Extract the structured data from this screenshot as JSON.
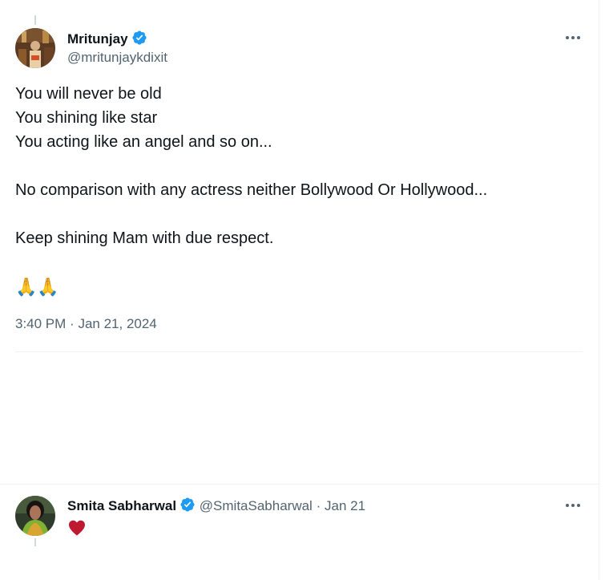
{
  "main_tweet": {
    "author_name": "Mritunjay",
    "author_handle": "@mritunjaykdixit",
    "verified": true,
    "lines": [
      "You will never be old",
      "You shining like star",
      "You acting like an angel and so on...",
      "",
      "No comparison with any actress neither Bollywood Or Hollywood...",
      "",
      "Keep shining Mam with due respect."
    ],
    "emoji": "🙏🙏",
    "time": "3:40 PM",
    "date": "Jan 21, 2024",
    "separator": "·",
    "more_icon": "more-horizontal-icon"
  },
  "reply": {
    "author_name": "Smita Sabharwal",
    "author_handle": "@SmitaSabharwal",
    "separator": "·",
    "date": "Jan 21",
    "verified": true,
    "content_icon": "red-heart-icon",
    "more_icon": "more-horizontal-icon"
  },
  "colors": {
    "verified_blue": "#1d9bf0",
    "secondary_text": "#536471",
    "divider": "#eff3f4",
    "heart_red": "#be1931"
  }
}
